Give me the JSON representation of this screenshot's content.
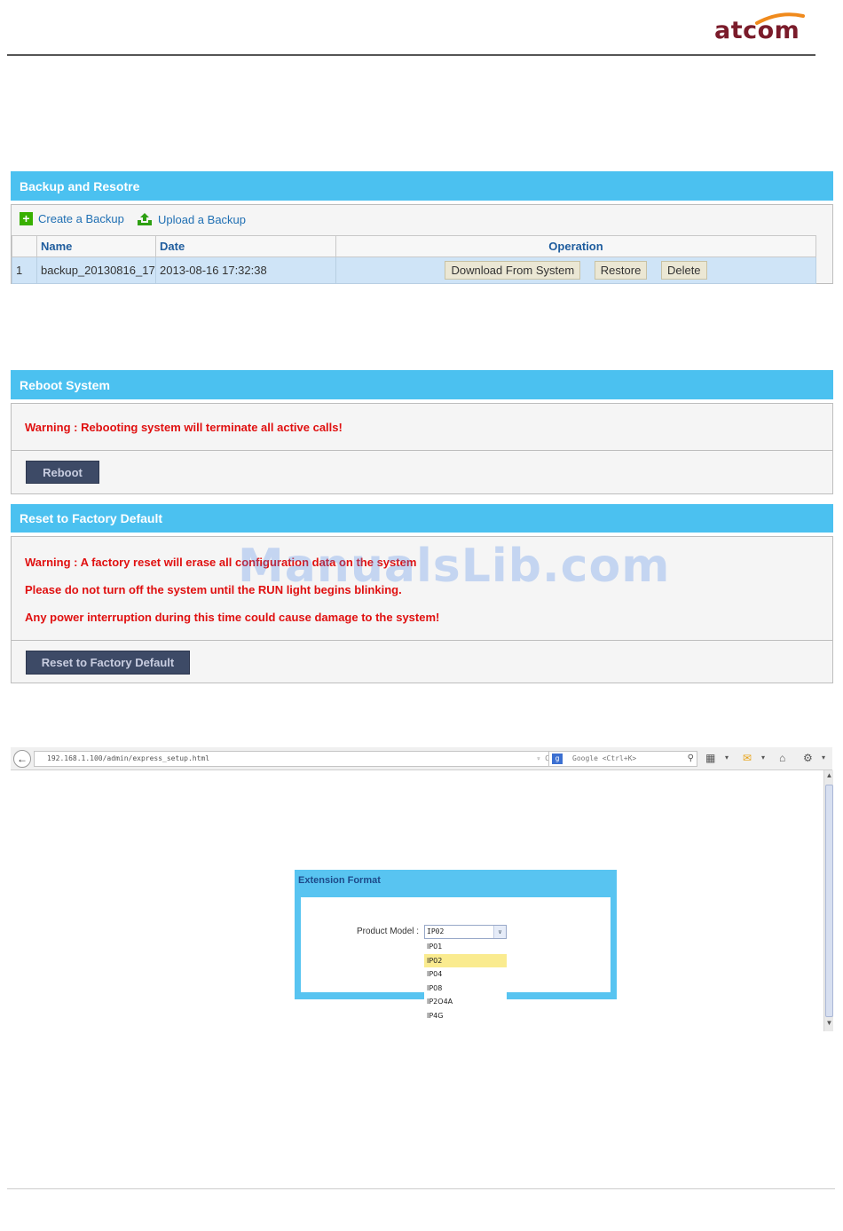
{
  "brand": {
    "logo_text": "atcom"
  },
  "backup": {
    "title": "Backup and Resotre",
    "create_label": "Create a Backup",
    "upload_label": "Upload a Backup",
    "columns": [
      "",
      "Name",
      "Date",
      "Operation"
    ],
    "rows": [
      {
        "index": "1",
        "name": "backup_20130816_17",
        "date": "2013-08-16 17:32:38"
      }
    ],
    "ops": {
      "download": "Download From System",
      "restore": "Restore",
      "delete": "Delete"
    }
  },
  "reboot": {
    "title": "Reboot System",
    "warning": "Warning : Rebooting system will terminate all active calls!",
    "button": "Reboot"
  },
  "factory": {
    "title": "Reset to Factory Default",
    "warnings": [
      "Warning : A factory reset will erase all configuration data on the system",
      "Please do not turn off the system until the RUN light begins blinking.",
      "Any power interruption during this time could cause damage to the system!"
    ],
    "button": "Reset to Factory Default"
  },
  "watermark": "ManualsLib.com",
  "browser": {
    "url": "192.168.1.100/admin/express_setup.html",
    "search_placeholder": "Google <Ctrl+K>"
  },
  "extension": {
    "title": "Extension Format",
    "label": "Product Model :",
    "selected": "IP02",
    "options": [
      "IP01",
      "IP02",
      "IP04",
      "IP08",
      "IP2O4A",
      "IP4G"
    ],
    "highlighted": "IP02"
  },
  "colors": {
    "panel_header": "#4bc1f0",
    "warning": "#e01010",
    "dark_button": "#3d4a66"
  }
}
